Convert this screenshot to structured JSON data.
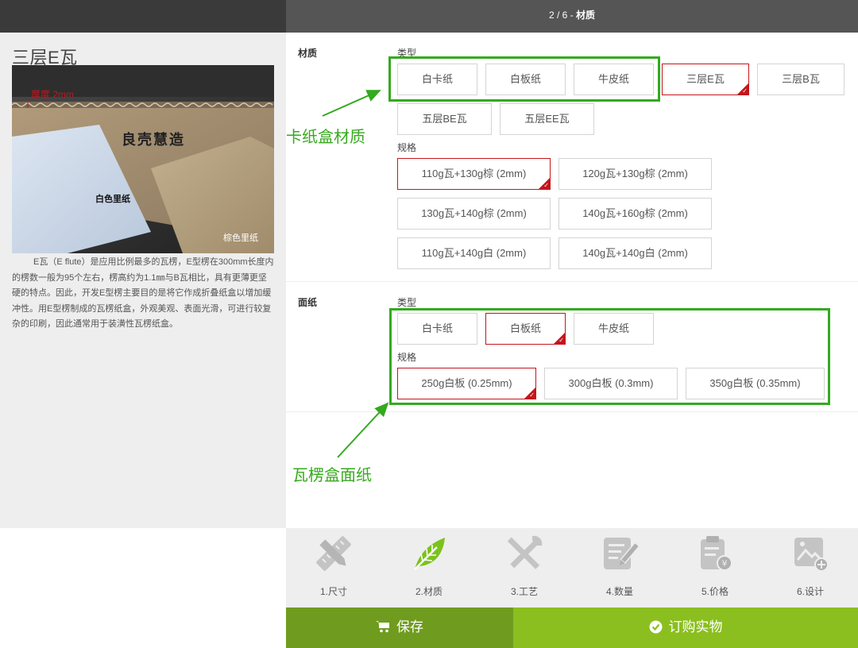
{
  "header": {
    "step_counter": "2 / 6 - ",
    "step_name": "材质"
  },
  "product": {
    "title": "三层E瓦",
    "photo_labels": {
      "thickness": "厚度 2mm",
      "brand": "良壳慧造",
      "white_liner": "白色里纸",
      "brown_liner": "棕色里纸"
    },
    "description": "E瓦（E flute）是应用比例最多的瓦楞，E型楞在300mm长度内的楞数一般为95个左右，楞高约为1.1㎜与B瓦相比，具有更薄更坚硬的特点。因此，开发E型楞主要目的是将它作成折叠纸盒以增加缓冲性。用E型楞制成的瓦楞纸盒，外观美观、表面光滑，可进行较复杂的印刷，因此通常用于装潢性瓦楞纸盒。"
  },
  "material": {
    "label": "材质",
    "type_label": "类型",
    "types": [
      {
        "label": "白卡纸",
        "selected": false
      },
      {
        "label": "白板纸",
        "selected": false
      },
      {
        "label": "牛皮纸",
        "selected": false
      },
      {
        "label": "三层E瓦",
        "selected": true
      },
      {
        "label": "三层B瓦",
        "selected": false
      },
      {
        "label": "五层BE瓦",
        "selected": false
      },
      {
        "label": "五层EE瓦",
        "selected": false
      }
    ],
    "spec_label": "规格",
    "specs": [
      {
        "label": "110g瓦+130g棕 (2mm)",
        "selected": true
      },
      {
        "label": "120g瓦+130g棕 (2mm)",
        "selected": false
      },
      {
        "label": "130g瓦+140g棕 (2mm)",
        "selected": false
      },
      {
        "label": "140g瓦+160g棕 (2mm)",
        "selected": false
      },
      {
        "label": "110g瓦+140g白 (2mm)",
        "selected": false
      },
      {
        "label": "140g瓦+140g白 (2mm)",
        "selected": false
      }
    ]
  },
  "facing": {
    "label": "面纸",
    "type_label": "类型",
    "types": [
      {
        "label": "白卡纸",
        "selected": false
      },
      {
        "label": "白板纸",
        "selected": true
      },
      {
        "label": "牛皮纸",
        "selected": false
      }
    ],
    "spec_label": "规格",
    "specs": [
      {
        "label": "250g白板 (0.25mm)",
        "selected": true
      },
      {
        "label": "300g白板 (0.3mm)",
        "selected": false
      },
      {
        "label": "350g白板 (0.35mm)",
        "selected": false
      }
    ]
  },
  "annotations": {
    "cardboard_material": "卡纸盒材质",
    "corrugated_facing": "瓦楞盒面纸"
  },
  "steps": [
    {
      "label": "1.尺寸",
      "icon": "ruler-pencil-icon",
      "active": false
    },
    {
      "label": "2.材质",
      "icon": "leaf-icon",
      "active": true
    },
    {
      "label": "3.工艺",
      "icon": "tools-icon",
      "active": false
    },
    {
      "label": "4.数量",
      "icon": "edit-list-icon",
      "active": false
    },
    {
      "label": "5.价格",
      "icon": "price-clipboard-icon",
      "active": false
    },
    {
      "label": "6.设计",
      "icon": "image-add-icon",
      "active": false
    }
  ],
  "actions": {
    "save": "保存",
    "order": "订购实物"
  },
  "colors": {
    "selected_border": "#c3161c",
    "annotation_green": "#33aa1f",
    "save_bg": "#6f9c1f",
    "order_bg": "#8bbf1f",
    "active_step": "#7cc21d"
  }
}
